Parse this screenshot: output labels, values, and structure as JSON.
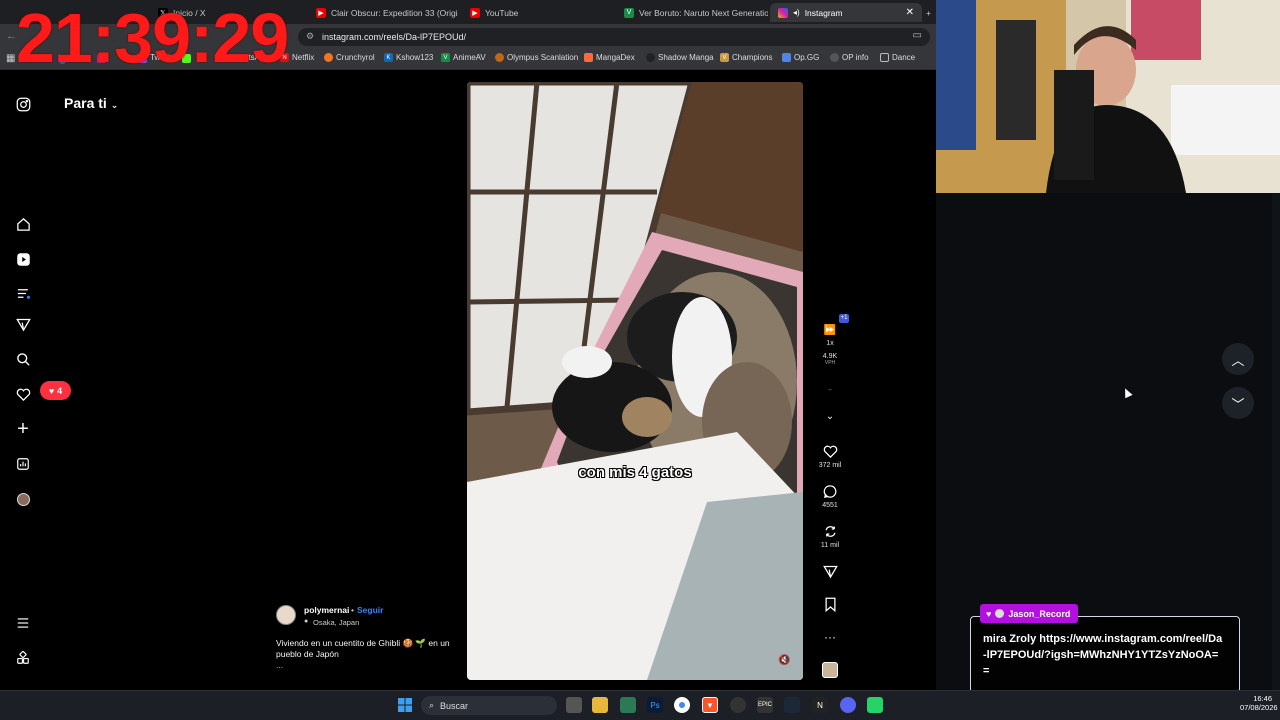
{
  "overlay": {
    "clock": "21:39:29"
  },
  "browser": {
    "tabs": [
      {
        "label": "Inicio / X",
        "active": false
      },
      {
        "label": "Clair Obscur: Expedition 33 (Original",
        "active": false
      },
      {
        "label": "YouTube",
        "active": false
      },
      {
        "label": "Ver Boruto: Naruto Next Generations",
        "active": false
      },
      {
        "label": "Instagram",
        "active": true
      }
    ],
    "url": "instagram.com/reels/Da-lP7EPOUd/",
    "bookmarks": [
      "Twitch",
      "WhatsApp",
      "Netflix",
      "Crunchyrol",
      "Kshow123",
      "AnimeAV",
      "Olympus Scanlation",
      "MangaDex",
      "Shadow Manga",
      "Champions",
      "Op.GG",
      "OP info",
      "Dance"
    ]
  },
  "instagram": {
    "feed_title": "Para ti",
    "notifications_count": "4",
    "video": {
      "subtitle": "con mis 4 gatos",
      "playback_speed": "1x",
      "speed_badge": "+1",
      "vph_value": "4.9K",
      "vph_label": "VPH"
    },
    "actions": {
      "likes": "372 mil",
      "comments": "4551",
      "reposts": "11 mil"
    },
    "author": {
      "username": "polymernai",
      "follow_label": "Seguir",
      "location": "Osaka, Japan",
      "caption": "Viviendo en un cuentito de Ghibli 🍪 🌱 en un pueblo de Japón",
      "more": "..."
    }
  },
  "chat": {
    "user": "Jason_Record",
    "message": "mira Zroly https://www.instagram.com/reel/Da-lP7EPOUd/?igsh=MWhzNHY1YTZsYzNoOA=="
  },
  "taskbar": {
    "search_label": "Buscar",
    "time": "16:46",
    "date": "07/08/2026"
  },
  "colors": {
    "clock": "#ff1a1a",
    "like_badge": "#ff3040",
    "follow_link": "#3b82f6",
    "chat_header": "#b310e0"
  }
}
